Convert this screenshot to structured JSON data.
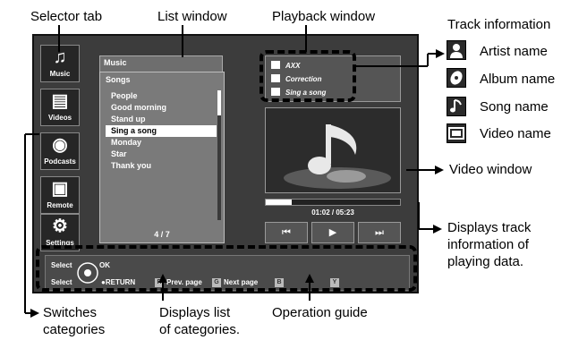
{
  "callouts": {
    "selector_tab": "Selector tab",
    "list_window": "List window",
    "playback_window": "Playback window",
    "track_information": "Track information",
    "video_window": "Video window",
    "displays_track_1": "Displays track",
    "displays_track_2": "information of",
    "displays_track_3": "playing data.",
    "switches_1": "Switches",
    "switches_2": "categories",
    "displays_list_1": "Displays list",
    "displays_list_2": "of categories.",
    "operation_guide": "Operation guide"
  },
  "legend": [
    {
      "label": "Artist name",
      "icon": "person-icon"
    },
    {
      "label": "Album name",
      "icon": "disc-icon"
    },
    {
      "label": "Song name",
      "icon": "music-note-icon"
    },
    {
      "label": "Video name",
      "icon": "film-icon"
    }
  ],
  "tabs": [
    {
      "label": "Music",
      "icon": "♫"
    },
    {
      "label": "Videos",
      "icon": "▤"
    },
    {
      "label": "Podcasts",
      "icon": "◉"
    },
    {
      "label": "Remote",
      "icon": "▣"
    },
    {
      "label": "Settings",
      "icon": "⚙"
    }
  ],
  "music_panel": {
    "title": "Music"
  },
  "list": {
    "header": "Songs",
    "items": [
      "People",
      "Good morning",
      "Stand up",
      "Sing a song",
      "Monday",
      "Star",
      "Thank you"
    ],
    "selected_index": 3,
    "page": "4 / 7"
  },
  "track": {
    "artist": "AXX",
    "album": "Correction",
    "song": "Sing a song"
  },
  "playback": {
    "time": "01:02 / 05:23",
    "progress": 0.19
  },
  "controls": {
    "prev": "⏮",
    "play": "▶",
    "next": "⏭"
  },
  "guide": {
    "select1": "Select",
    "ok": "OK",
    "select2": "Select",
    "return": "●RETURN",
    "key_r": "R",
    "prev_page": "Prev. page",
    "key_g": "G",
    "next_page": "Next page",
    "key_b": "B",
    "key_y": "Y"
  }
}
